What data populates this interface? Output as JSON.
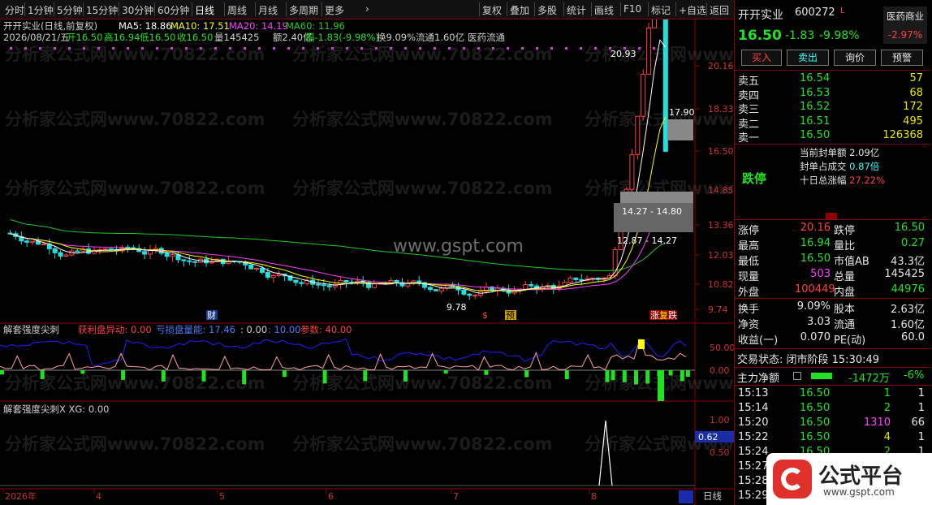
{
  "toolbar": {
    "left_items": [
      "分时",
      "1分钟",
      "5分钟",
      "15分钟",
      "30分钟",
      "60分钟",
      "日线",
      "周线",
      "月线",
      "多周期",
      "更多"
    ],
    "right_items": [
      "复权",
      "叠加",
      "多股",
      "统计",
      "画线",
      "F10",
      "标记",
      "+自选",
      "返回"
    ]
  },
  "chart_header": {
    "title": "开开实业(日线,前复权)",
    "ma5": "MA5: 18.86",
    "ma10": "MA10: 17.51",
    "ma20": "MA20: 14.19",
    "ma60": "MA60: 11.96",
    "date_line": "2026/08/21/五",
    "open": "开16.50",
    "high": "高16.94",
    "low": "低16.50",
    "close": "收16.50",
    "vol": "量145425",
    "amount": "额2.40亿",
    "amp": "幅-1.83(-9.98%)",
    "turnover": "换9.09%",
    "float": "流通1.60亿",
    "sector": "医药流通"
  },
  "y_axis_main": [
    "20.16",
    "18.33",
    "16.50",
    "14.85",
    "13.36",
    "12.03",
    "10.82",
    "9.74"
  ],
  "annotations": {
    "high": "20.93",
    "low": "9.78",
    "box_top": "17.90",
    "box_mid": "14.27 - 14.80",
    "box_low": "12.87 - 14.27",
    "site": "www.gspt.com",
    "marker_cai": "财",
    "marker_yu": "预",
    "marker_s": "$",
    "marker_zt": "涨",
    "marker_dt": "跌",
    "marker_fu": "复"
  },
  "indicator1": {
    "title": "解套强度尖刺",
    "profit": "获利盘异动: 0.00",
    "trapped": "亏损盘量能: 17.46",
    "v1": ": 0.00",
    "v2": ": 10.00",
    "param": "参数: 40.00",
    "y": [
      "50.00",
      "0.00"
    ]
  },
  "indicator2": {
    "title": "解套强度尖刺X XG: 0.00",
    "y": [
      "1.00",
      "0.50"
    ],
    "current": "0.62"
  },
  "x_axis": [
    "2026年",
    "4",
    "5",
    "6",
    "7",
    "8"
  ],
  "x_axis_right": "日线",
  "stock": {
    "name": "开开实业",
    "code": "600272",
    "flag": "L",
    "sector": "医药商业",
    "sector_change": "-2.97%",
    "price": "16.50",
    "change": "-1.83",
    "change_pct": "-9.98%",
    "buttons": [
      "买入",
      "卖出",
      "询价",
      "预警"
    ]
  },
  "order_book": [
    {
      "label": "卖五",
      "price": "16.54",
      "vol": "57"
    },
    {
      "label": "卖四",
      "price": "16.53",
      "vol": "68"
    },
    {
      "label": "卖三",
      "price": "16.52",
      "vol": "172"
    },
    {
      "label": "卖二",
      "price": "16.51",
      "vol": "495"
    },
    {
      "label": "卖一",
      "price": "16.50",
      "vol": "126368"
    }
  ],
  "limit_info": {
    "status": "跌停",
    "seal_amount_label": "当前封单额",
    "seal_amount": "2.09亿",
    "seal_ratio_label": "封单占成交",
    "seal_ratio": "0.87倍",
    "ten_day_label": "十日总涨幅",
    "ten_day": "27.22%"
  },
  "quote_stats": [
    [
      {
        "k": "涨停",
        "v": "20.16",
        "c": "red"
      },
      {
        "k": "跌停",
        "v": "16.50",
        "c": "green"
      }
    ],
    [
      {
        "k": "最高",
        "v": "16.94",
        "c": "green"
      },
      {
        "k": "量比",
        "v": "0.27",
        "c": "green"
      }
    ],
    [
      {
        "k": "最低",
        "v": "16.50",
        "c": "green"
      },
      {
        "k": "市值AB",
        "v": "43.3亿",
        "c": "white"
      }
    ],
    [
      {
        "k": "现量",
        "v": "503",
        "c": "magenta"
      },
      {
        "k": "总量",
        "v": "145425",
        "c": "white"
      }
    ],
    [
      {
        "k": "外盘",
        "v": "100449",
        "c": "red"
      },
      {
        "k": "内盘",
        "v": "44976",
        "c": "green"
      }
    ]
  ],
  "fund_stats": [
    [
      {
        "k": "换手",
        "v": "9.09%"
      },
      {
        "k": "股本",
        "v": "2.63亿"
      }
    ],
    [
      {
        "k": "净资",
        "v": "3.03"
      },
      {
        "k": "流通",
        "v": "1.60亿"
      }
    ],
    [
      {
        "k": "收益(一)",
        "v": "0.070"
      },
      {
        "k": "PE(动)",
        "v": "60.0"
      }
    ]
  ],
  "trade_status": "交易状态: 闭市阶段 15:30:49",
  "main_flow": {
    "label": "主力净额",
    "value": "-1472万",
    "pct": "-6%"
  },
  "ticks": [
    {
      "t": "15:13",
      "p": "16.50",
      "v": "1",
      "n": "1",
      "vc": "green"
    },
    {
      "t": "15:14",
      "p": "16.50",
      "v": "2",
      "n": "1",
      "vc": "green"
    },
    {
      "t": "15:20",
      "p": "16.50",
      "v": "1310",
      "n": "66",
      "vc": "magenta"
    },
    {
      "t": "15:22",
      "p": "16.50",
      "v": "4",
      "n": "1",
      "vc": "yellow"
    },
    {
      "t": "15:24",
      "p": "16.50",
      "v": "2",
      "n": "1",
      "vc": "green"
    },
    {
      "t": "15:27",
      "p": "",
      "v": "",
      "n": "",
      "vc": "green"
    },
    {
      "t": "15:28",
      "p": "",
      "v": "",
      "n": "",
      "vc": "green"
    },
    {
      "t": "15:29",
      "p": "",
      "v": "",
      "n": "",
      "vc": "green"
    }
  ],
  "logo": {
    "text": "公式平台",
    "url": "www.gspt.com"
  },
  "watermark": "分析家公式网www.70822.com",
  "colors": {
    "up": "#ff4040",
    "down": "#22e0e0",
    "ma5": "#ffffff",
    "ma10": "#ffff00",
    "ma20": "#ff40ff",
    "ma60": "#22cc22"
  }
}
